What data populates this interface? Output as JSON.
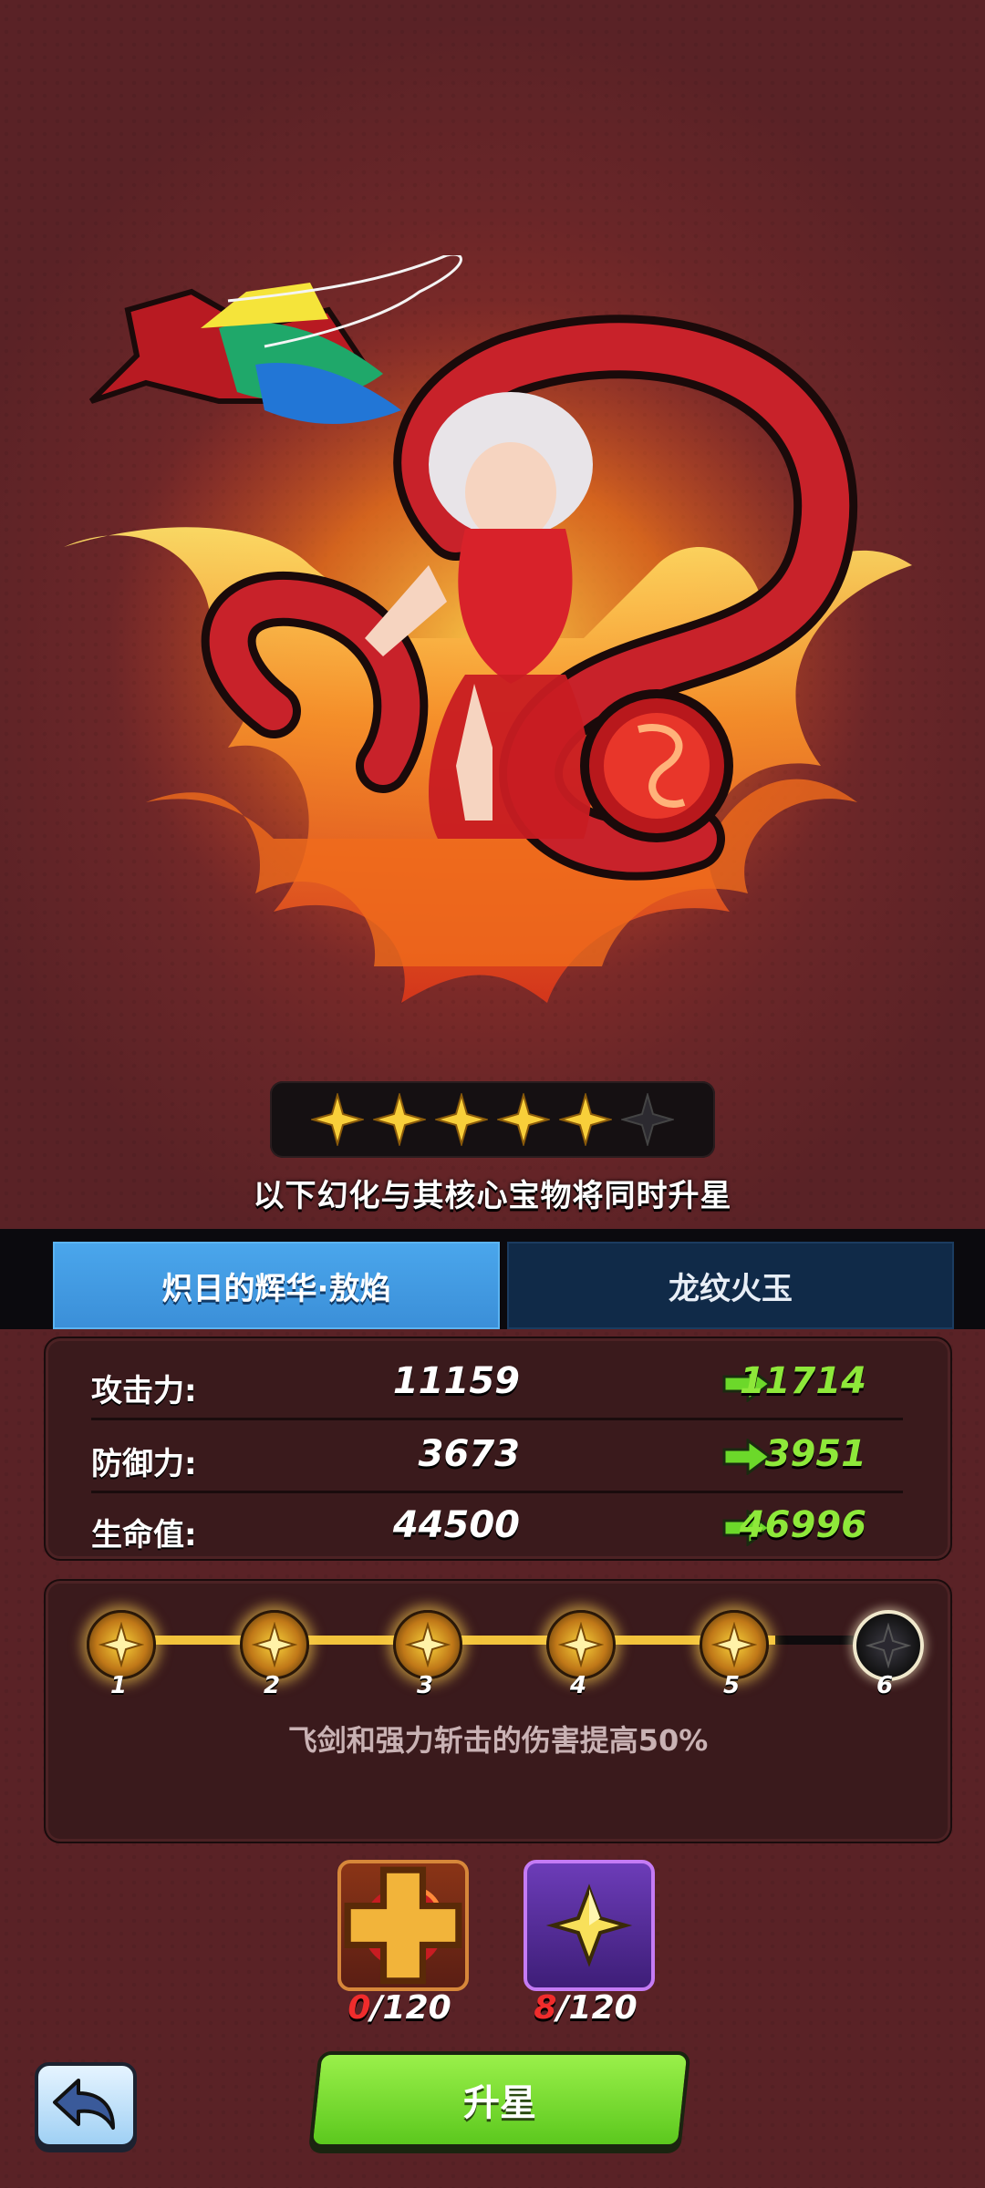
{
  "stars": {
    "filled": 5,
    "total": 6
  },
  "subtitle": "以下幻化与其核心宝物将同时升星",
  "tabs": [
    {
      "label": "炽日的辉华·敖焰",
      "active": true
    },
    {
      "label": "龙纹火玉",
      "active": false
    }
  ],
  "stats": [
    {
      "label": "攻击力:",
      "current": "11159",
      "next": "11714"
    },
    {
      "label": "防御力:",
      "current": "3673",
      "next": "3951"
    },
    {
      "label": "生命值:",
      "current": "44500",
      "next": "46996"
    }
  ],
  "progression": {
    "nodes": [
      "1",
      "2",
      "3",
      "4",
      "5",
      "6"
    ],
    "reached": 5,
    "description": "飞剑和强力斩击的伤害提高50%"
  },
  "materials": [
    {
      "icon": "dragon-jade-icon",
      "have": "0",
      "need": "/120"
    },
    {
      "icon": "star-shard-icon",
      "have": "8",
      "need": "/120"
    }
  ],
  "buttons": {
    "upgrade_label": "升星",
    "back_icon": "back-arrow-icon"
  },
  "colors": {
    "accent_green": "#8ee83a",
    "tab_blue": "#3b8fd8",
    "insufficient_red": "#f02c2c"
  }
}
